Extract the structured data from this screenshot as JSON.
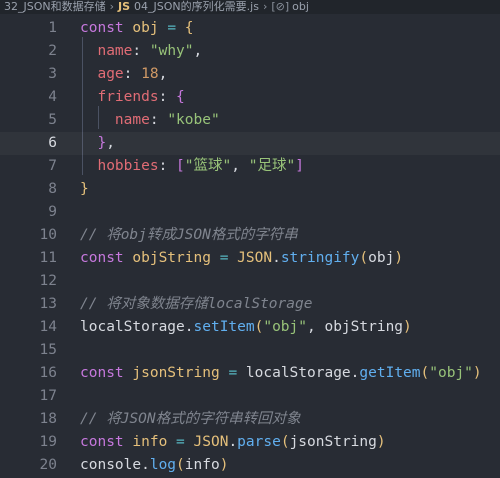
{
  "breadcrumb": {
    "folder": "32_JSON和数据存储",
    "file_badge": "JS",
    "file": "04_JSON的序列化需要.js",
    "symbol_icon": "[⊘]",
    "symbol": "obj"
  },
  "editor": {
    "active_line": 6,
    "lines": [
      {
        "n": "1",
        "t": [
          "const",
          "obj",
          "=",
          "{"
        ]
      },
      {
        "n": "2",
        "t": [
          "name",
          ":",
          "\"why\"",
          ","
        ]
      },
      {
        "n": "3",
        "t": [
          "age",
          ":",
          "18",
          ","
        ]
      },
      {
        "n": "4",
        "t": [
          "friends",
          ":",
          "{"
        ]
      },
      {
        "n": "5",
        "t": [
          "name",
          ":",
          "\"kobe\""
        ]
      },
      {
        "n": "6",
        "t": [
          "}",
          ","
        ]
      },
      {
        "n": "7",
        "t": [
          "hobbies",
          ":",
          "[",
          "\"篮球\"",
          ",",
          "\"足球\"",
          "]"
        ]
      },
      {
        "n": "8",
        "t": [
          "}"
        ]
      },
      {
        "n": "9",
        "t": []
      },
      {
        "n": "10",
        "t": [
          "// 将obj转成JSON格式的字符串"
        ]
      },
      {
        "n": "11",
        "t": [
          "const",
          "objString",
          "=",
          "JSON",
          ".",
          "stringify",
          "(",
          "obj",
          ")"
        ]
      },
      {
        "n": "12",
        "t": []
      },
      {
        "n": "13",
        "t": [
          "// 将对象数据存储localStorage"
        ]
      },
      {
        "n": "14",
        "t": [
          "localStorage",
          ".",
          "setItem",
          "(",
          "\"obj\"",
          ",",
          "objString",
          ")"
        ]
      },
      {
        "n": "15",
        "t": []
      },
      {
        "n": "16",
        "t": [
          "const",
          "jsonString",
          "=",
          "localStorage",
          ".",
          "getItem",
          "(",
          "\"obj\"",
          ")"
        ]
      },
      {
        "n": "17",
        "t": []
      },
      {
        "n": "18",
        "t": [
          "// 将JSON格式的字符串转回对象"
        ]
      },
      {
        "n": "19",
        "t": [
          "const",
          "info",
          "=",
          "JSON",
          ".",
          "parse",
          "(",
          "jsonString",
          ")"
        ]
      },
      {
        "n": "20",
        "t": [
          "console",
          ".",
          "log",
          "(",
          "info",
          ")"
        ]
      }
    ]
  }
}
